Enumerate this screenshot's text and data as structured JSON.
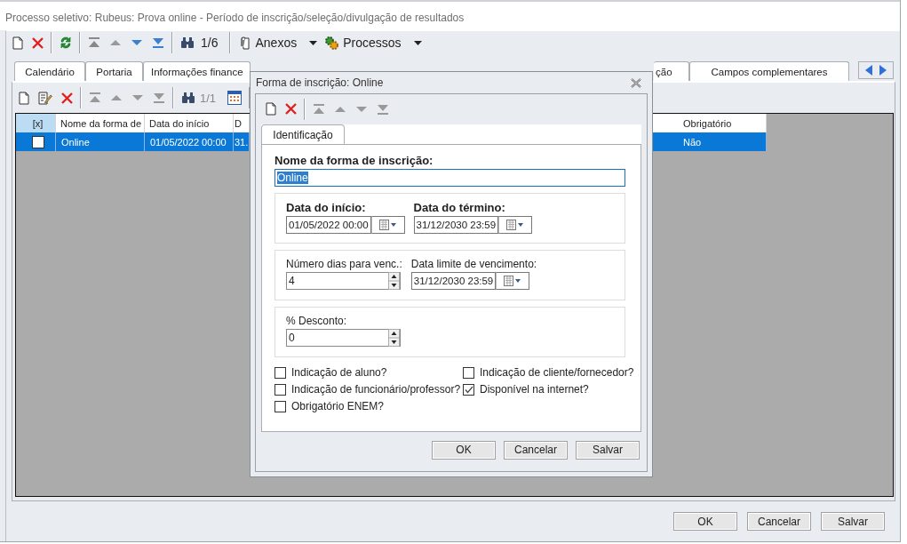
{
  "window": {
    "title": "Processo seletivo: Rubeus: Prova online - Período de inscrição/seleção/divulgação de resultados"
  },
  "toolbar": {
    "record_counter": "1/6",
    "menus": [
      {
        "label": "Anexos",
        "kind": "attachments"
      },
      {
        "label": "Processos",
        "kind": "processes"
      }
    ]
  },
  "tabs": [
    {
      "label": "Calendário",
      "selected": false
    },
    {
      "label": "Portaria",
      "selected": false
    },
    {
      "label": "Informações finance",
      "selected": false
    },
    {
      "label": "ção",
      "selected": false
    },
    {
      "label": "Campos complementares",
      "selected": false
    }
  ],
  "sub_toolbar": {
    "record_counter": "1/1"
  },
  "table": {
    "selector_column": "[x]",
    "columns": [
      "Nome da forma de",
      "Data do início",
      "D",
      "Obrigatório"
    ],
    "rows": [
      {
        "selected": true,
        "checked": false,
        "cells": [
          "Online",
          "01/05/2022 00:00",
          "31.",
          "Não"
        ]
      }
    ]
  },
  "buttons": [
    "OK",
    "Cancelar",
    "Salvar"
  ],
  "dialog": {
    "title": "Forma de inscrição: Online",
    "tabs": [
      {
        "label": "Identificação",
        "selected": true
      }
    ],
    "name_field": {
      "label": "Nome da forma de inscrição:",
      "value": "Online"
    },
    "groups": [
      {
        "fields": [
          {
            "kind": "date",
            "label": "Data do início:",
            "value": "01/05/2022 00:00",
            "required": true
          },
          {
            "kind": "date",
            "label": "Data do término:",
            "value": "31/12/2030 23:59",
            "required": true
          }
        ]
      },
      {
        "fields": [
          {
            "kind": "spin",
            "label": "Número dias para venc.:",
            "value": "4",
            "required": false
          },
          {
            "kind": "date",
            "label": "Data limite de vencimento:",
            "value": "31/12/2030 23:59",
            "required": false
          }
        ]
      },
      {
        "fields": [
          {
            "kind": "spin",
            "label": "% Desconto:",
            "value": "0",
            "required": false
          }
        ]
      }
    ],
    "checkboxes": [
      {
        "label": "Indicação de aluno?",
        "checked": false
      },
      {
        "label": "Indicação de cliente/fornecedor?",
        "checked": false
      },
      {
        "label": "Indicação de funcionário/professor?",
        "checked": false
      },
      {
        "label": "Disponível na internet?",
        "checked": true
      },
      {
        "label": "Obrigatório ENEM?",
        "checked": false
      }
    ],
    "buttons": [
      "OK",
      "Cancelar",
      "Salvar"
    ]
  }
}
